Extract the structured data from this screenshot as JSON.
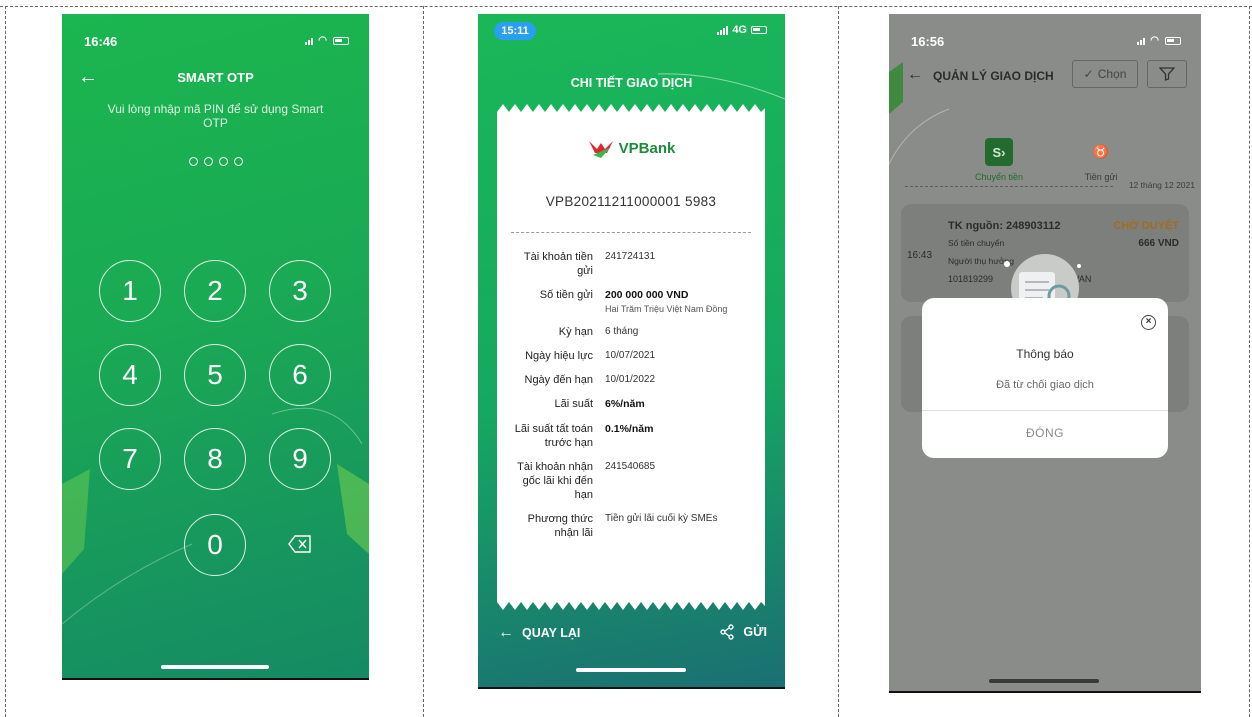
{
  "phone1": {
    "status_time": "16:46",
    "title": "SMART OTP",
    "subtitle": "Vui lòng nhập mã PIN để sử dụng Smart OTP",
    "keys": [
      "1",
      "2",
      "3",
      "4",
      "5",
      "6",
      "7",
      "8",
      "9",
      "0"
    ],
    "colors": {
      "bg_top": "#1bb64f",
      "bg_bottom": "#158a64"
    }
  },
  "phone2": {
    "status_time": "15:11",
    "network": "4G",
    "title": "CHI TIẾT GIAO DỊCH",
    "bank_logo": "VPBank",
    "transaction_id": "VPB20211211000001 5983",
    "rows": [
      {
        "label": "Tài khoản tiền gửi",
        "value": "241724131"
      },
      {
        "label": "Số tiền gửi",
        "value": "200 000 000 VND",
        "sub": "Hai Trăm Triệu Việt Nam Đồng"
      },
      {
        "label": "Kỳ hạn",
        "value": "6 tháng"
      },
      {
        "label": "Ngày hiệu lực",
        "value": "10/07/2021"
      },
      {
        "label": "Ngày đến hạn",
        "value": "10/01/2022"
      },
      {
        "label": "Lãi suất",
        "value": "6%/năm"
      },
      {
        "label": "Lãi suất tất toán trước hạn",
        "value": "0.1%/năm"
      },
      {
        "label": "Tài khoản nhận gốc lãi khi đến hạn",
        "value": "241540685"
      },
      {
        "label": "Phương thức nhận lãi",
        "value": "Tiền gửi lãi cuối kỳ SMEs"
      }
    ],
    "back_label": "QUAY LẠI",
    "send_label": "GỬI"
  },
  "phone3": {
    "status_time": "16:56",
    "header_title": "QUẢN LÝ GIAO DỊCH",
    "select_label": "Chọn",
    "tabs": [
      {
        "label": "Chuyển tiền",
        "icon": "transfer-icon"
      },
      {
        "label": "Tiền gửi",
        "icon": "piggy-bank-icon"
      }
    ],
    "date_label": "12 tháng 12 2021",
    "card1": {
      "time": "16:43",
      "source": "TK nguồn: 248903112",
      "status": "CHỜ DUYỆT",
      "amount_label": "Số tiền chuyển",
      "amount": "666 VND",
      "recipient_label": "Người thụ hưởng",
      "recipient_account": "101819299",
      "recipient_name": "CẨM VAN"
    },
    "modal": {
      "title": "Thông báo",
      "message": "Đã từ chối giao dịch",
      "button": "ĐÓNG"
    }
  }
}
